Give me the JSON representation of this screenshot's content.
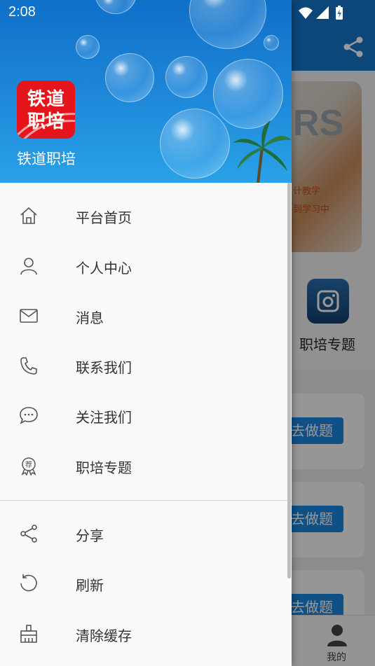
{
  "status_bar": {
    "time": "2:08"
  },
  "background_app": {
    "banner_big_text": "RS",
    "banner_line1": "计教学",
    "banner_line2": "到学习中",
    "topic_label": "职培专题",
    "card_button_label": "去做题",
    "nav_mine_label": "我的"
  },
  "drawer": {
    "header": {
      "logo_line1": "铁道",
      "logo_line2": "职培",
      "app_name": "铁道职培"
    },
    "items": [
      {
        "label": "平台首页",
        "icon": "home-icon"
      },
      {
        "label": "个人中心",
        "icon": "user-icon"
      },
      {
        "label": "消息",
        "icon": "mail-icon"
      },
      {
        "label": "联系我们",
        "icon": "phone-icon"
      },
      {
        "label": "关注我们",
        "icon": "chat-bubble-icon"
      },
      {
        "label": "职培专题",
        "icon": "recommend-badge-icon"
      }
    ],
    "secondary_items": [
      {
        "label": "分享",
        "icon": "share-icon"
      },
      {
        "label": "刷新",
        "icon": "refresh-icon"
      },
      {
        "label": "清除缓存",
        "icon": "broom-icon"
      }
    ],
    "badge_char": "荐"
  },
  "colors": {
    "primary": "#1675c9",
    "logo_red": "#e6141b",
    "button_blue": "#1a86e0"
  }
}
